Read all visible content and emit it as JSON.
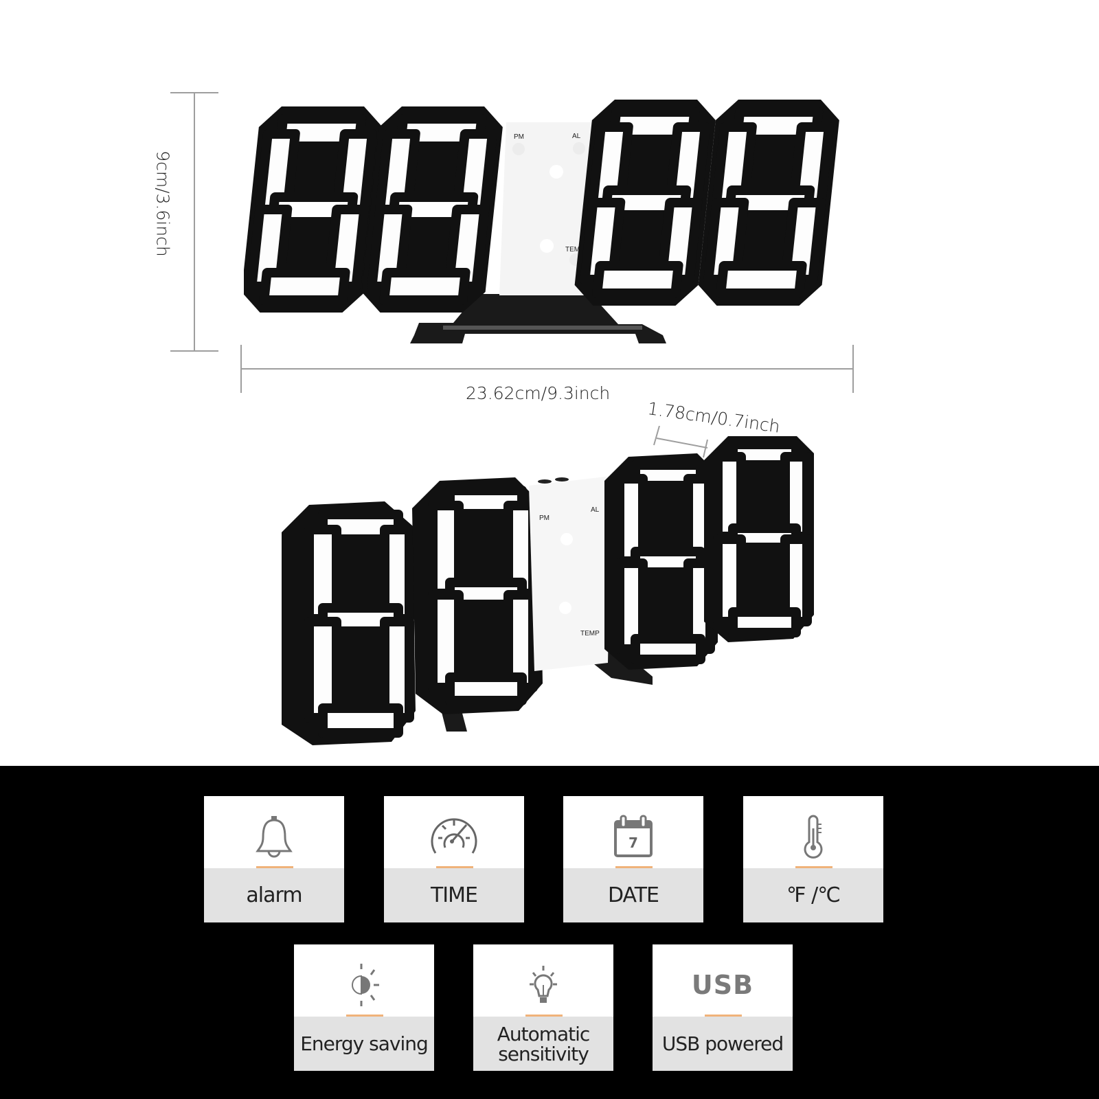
{
  "product": {
    "top_view": {
      "height_dimension": "9cm/3.6inch",
      "width_dimension": "23.62cm/9.3inch",
      "panel_labels": {
        "pm": "PM",
        "al": "AL",
        "temp": "TEMP"
      }
    },
    "angled_view": {
      "depth_dimension": "1.78cm/0.7inch",
      "panel_labels": {
        "pm": "PM",
        "al": "AL",
        "temp": "TEMP"
      }
    }
  },
  "features": {
    "row1": [
      {
        "icon": "bell-icon",
        "label": "alarm"
      },
      {
        "icon": "speedometer-icon",
        "label": "TIME"
      },
      {
        "icon": "calendar-icon",
        "label": "DATE",
        "icon_text": "7"
      },
      {
        "icon": "thermometer-icon",
        "label": "℉ /℃"
      }
    ],
    "row2": [
      {
        "icon": "brightness-icon",
        "label": "Energy saving"
      },
      {
        "icon": "lightbulb-icon",
        "label_line1": "Automatic",
        "label_line2": "sensitivity"
      },
      {
        "icon": "usb-icon",
        "icon_text": "USB",
        "label": "USB powered"
      }
    ]
  },
  "colors": {
    "accent": "#f0b27a",
    "label_bg": "#e2e2e2",
    "band": "#000000",
    "dimension_line": "#9e9e9e"
  }
}
